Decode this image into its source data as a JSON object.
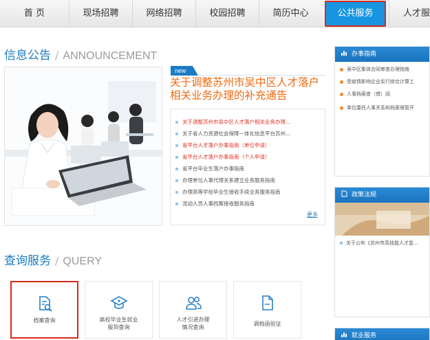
{
  "nav": {
    "items": [
      "首 页",
      "现场招聘",
      "网络招聘",
      "校园招聘",
      "简历中心",
      "公共服务",
      "人才服务"
    ],
    "active_index": 5
  },
  "announcement": {
    "title_cn": "信息公告",
    "title_en": "ANNOUNCEMENT",
    "badge": "new",
    "headline": "关于调整苏州市吴中区人才落户相关业务办理的补充通告",
    "items": [
      {
        "text": "关于调整苏州市吴中区人才落户相关业务办理...",
        "highlight": true
      },
      {
        "text": "关于省人力资源社会保障一体化信息平台苏州...",
        "highlight": false
      },
      {
        "text": "省平台人才落户办事指南（单位申请）",
        "highlight": true
      },
      {
        "text": "省平台人才落户办事指南（个人申请）",
        "highlight": true
      },
      {
        "text": "省平台毕业生落户办事指南",
        "highlight": false
      },
      {
        "text": "办理单位人事代理关系建立业务服务指南",
        "highlight": false
      },
      {
        "text": "办理高等学校毕业生接收手续业务服务指南",
        "highlight": false
      },
      {
        "text": "流动人员人事档案接收服务指南",
        "highlight": false
      }
    ],
    "more": "更多"
  },
  "query": {
    "title_cn": "查询服务",
    "title_en": "QUERY",
    "cards": [
      {
        "icon": "file-search-icon",
        "line1": "档案查询",
        "line2": ""
      },
      {
        "icon": "graduation-cap-icon",
        "line1": "高校毕业生就业",
        "line2": "报到查询"
      },
      {
        "icon": "users-icon",
        "line1": "人才引进办理",
        "line2": "情况查询"
      },
      {
        "icon": "document-icon",
        "line1": "调档函验证",
        "line2": ""
      }
    ]
  },
  "side": {
    "guide": {
      "title": "办事指南",
      "items": [
        "吴中区集体合同审查办理指南",
        "受疫情影响企业实行综合计算工",
        "人事档案查（借）阅",
        "单位委托人事关系和档案保管开"
      ]
    },
    "policy": {
      "title": "政策法规",
      "items": [
        "关于公布《苏州市高技能人才复..."
      ]
    },
    "employment": {
      "title": "就业服务"
    }
  },
  "colors": {
    "brand_blue": "#1a7cc4",
    "active_nav": "#1895e0",
    "selection_red": "#d9271c",
    "headline_orange": "#ef6a12",
    "highlight_red": "#e0342a"
  }
}
